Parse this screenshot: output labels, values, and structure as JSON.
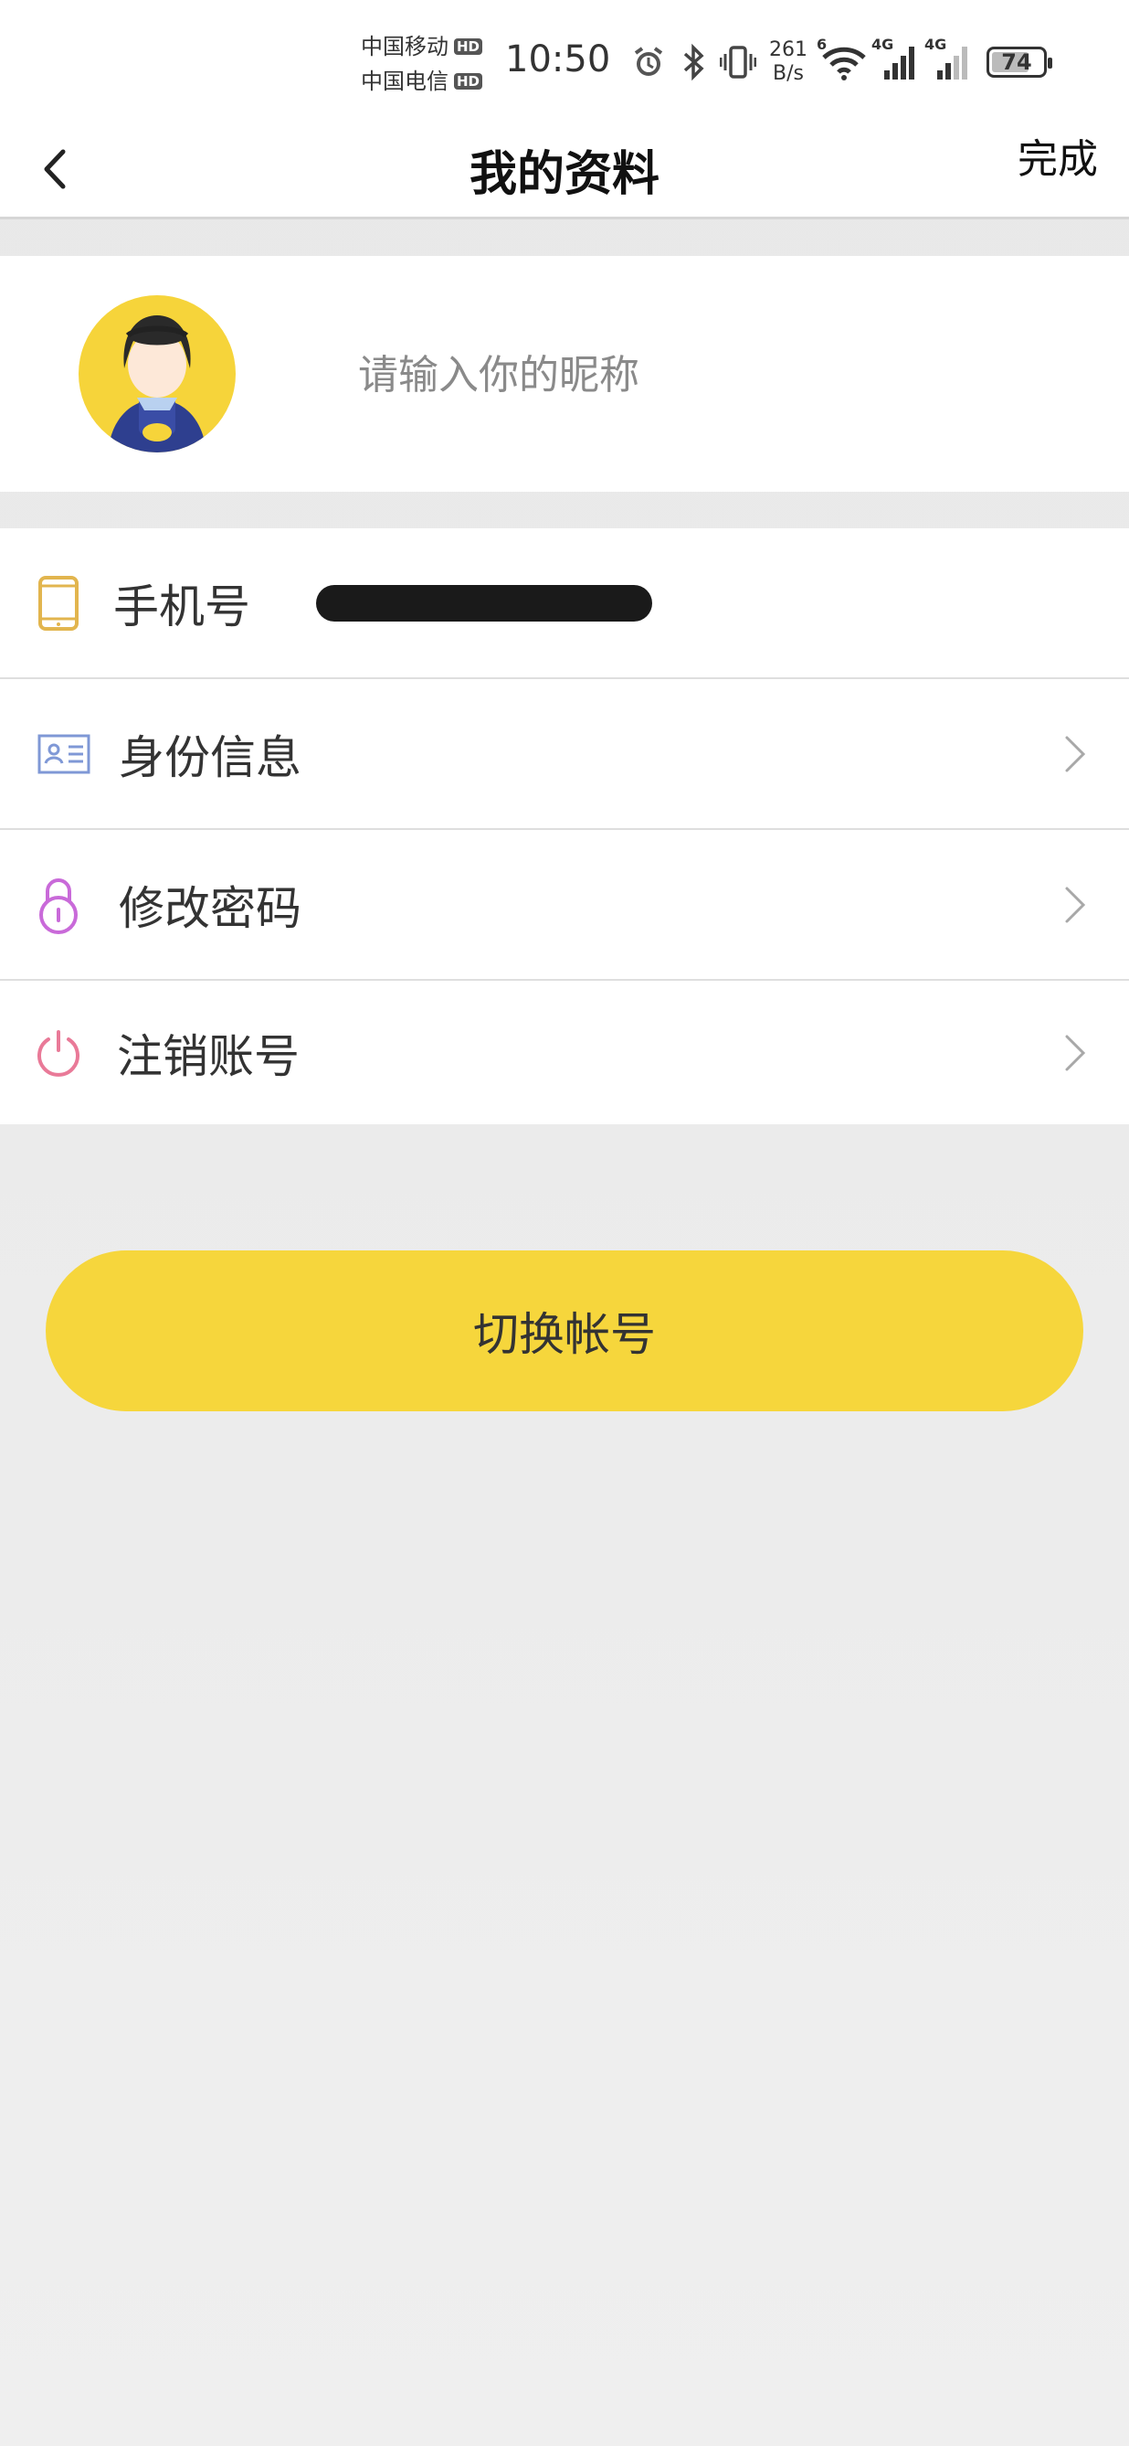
{
  "status_bar": {
    "carrier_1": "中国移动",
    "carrier_2": "中国电信",
    "hd_label": "HD",
    "time": "10:50",
    "net_speed_value": "261",
    "net_speed_unit": "B/s",
    "signal_label_1": "4G",
    "signal_label_2": "4G",
    "wifi_label": "6",
    "battery_level": "74",
    "battery_fraction": 0.74,
    "icons": [
      "alarm-icon",
      "bluetooth-icon",
      "vibrate-icon",
      "wifi-icon",
      "signal-icon",
      "battery-icon"
    ]
  },
  "nav": {
    "title": "我的资料",
    "done_label": "完成",
    "back_icon": "chevron-left-icon"
  },
  "profile": {
    "nickname_value": "",
    "nickname_placeholder": "请输入你的昵称",
    "avatar": "cartoon-avatar"
  },
  "settings": {
    "phone_label": "手机号",
    "identity_label": "身份信息",
    "password_label": "修改密码",
    "cancel_account_label": "注销账号"
  },
  "actions": {
    "switch_account_label": "切换帐号"
  },
  "colors": {
    "accent": "#f6d63c",
    "phone_icon": "#e2b54e",
    "identity_icon": "#7f98d6",
    "password_icon": "#c96ad9",
    "power_icon": "#e97a98"
  }
}
